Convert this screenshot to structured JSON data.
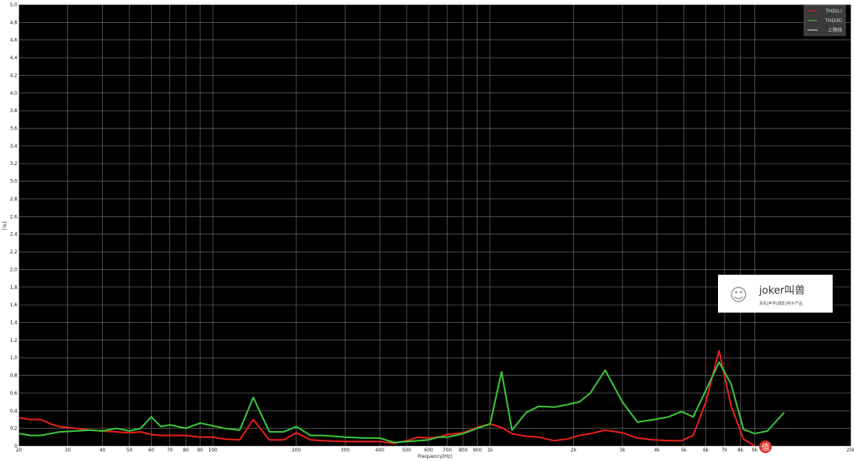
{
  "chart_data": {
    "type": "line",
    "xlabel": "Frequency[Hz]",
    "ylabel": "[%]",
    "xscale": "log",
    "xlim": [
      20,
      20000
    ],
    "ylim": [
      0,
      5
    ],
    "grid": true,
    "legend_position": "top-right",
    "background": "#000000",
    "y_ticks": [
      "0",
      "0,2",
      "0,4",
      "0,6",
      "0,8",
      "1,0",
      "1,2",
      "1,4",
      "1,6",
      "1,8",
      "2,0",
      "2,2",
      "2,4",
      "2,6",
      "2,8",
      "3,0",
      "3,2",
      "3,4",
      "3,6",
      "3,8",
      "4,0",
      "4,2",
      "4,4",
      "4,6",
      "4,8",
      "5,0"
    ],
    "x_ticks": [
      {
        "value": 20,
        "label": "20"
      },
      {
        "value": 30,
        "label": "30"
      },
      {
        "value": 40,
        "label": "40"
      },
      {
        "value": 50,
        "label": "50"
      },
      {
        "value": 60,
        "label": "60"
      },
      {
        "value": 70,
        "label": "70"
      },
      {
        "value": 80,
        "label": "80"
      },
      {
        "value": 90,
        "label": "90"
      },
      {
        "value": 100,
        "label": "100"
      },
      {
        "value": 200,
        "label": "200"
      },
      {
        "value": 300,
        "label": "300"
      },
      {
        "value": 400,
        "label": "400"
      },
      {
        "value": 500,
        "label": "500"
      },
      {
        "value": 600,
        "label": "600"
      },
      {
        "value": 700,
        "label": "700"
      },
      {
        "value": 800,
        "label": "800"
      },
      {
        "value": 900,
        "label": "900"
      },
      {
        "value": 1000,
        "label": "1k"
      },
      {
        "value": 2000,
        "label": "2k"
      },
      {
        "value": 3000,
        "label": "3k"
      },
      {
        "value": 4000,
        "label": "4k"
      },
      {
        "value": 5000,
        "label": "5k"
      },
      {
        "value": 6000,
        "label": "6k"
      },
      {
        "value": 7000,
        "label": "7k"
      },
      {
        "value": 8000,
        "label": "8k"
      },
      {
        "value": 9000,
        "label": "9k"
      },
      {
        "value": 20000,
        "label": "20k"
      }
    ],
    "series": [
      {
        "name": "THD(L)",
        "color": "#e8201c",
        "points": [
          [
            20,
            0.32
          ],
          [
            22,
            0.3
          ],
          [
            24,
            0.3
          ],
          [
            26,
            0.25
          ],
          [
            28,
            0.22
          ],
          [
            32,
            0.2
          ],
          [
            36,
            0.18
          ],
          [
            40,
            0.17
          ],
          [
            45,
            0.16
          ],
          [
            50,
            0.15
          ],
          [
            55,
            0.16
          ],
          [
            60,
            0.13
          ],
          [
            65,
            0.12
          ],
          [
            70,
            0.12
          ],
          [
            80,
            0.12
          ],
          [
            90,
            0.1
          ],
          [
            100,
            0.1
          ],
          [
            110,
            0.08
          ],
          [
            125,
            0.07
          ],
          [
            140,
            0.3
          ],
          [
            160,
            0.07
          ],
          [
            180,
            0.07
          ],
          [
            200,
            0.15
          ],
          [
            225,
            0.07
          ],
          [
            250,
            0.06
          ],
          [
            300,
            0.05
          ],
          [
            350,
            0.05
          ],
          [
            400,
            0.05
          ],
          [
            450,
            0.03
          ],
          [
            500,
            0.06
          ],
          [
            550,
            0.1
          ],
          [
            600,
            0.09
          ],
          [
            650,
            0.1
          ],
          [
            700,
            0.13
          ],
          [
            750,
            0.14
          ],
          [
            800,
            0.15
          ],
          [
            900,
            0.21
          ],
          [
            1000,
            0.25
          ],
          [
            1100,
            0.21
          ],
          [
            1200,
            0.14
          ],
          [
            1350,
            0.11
          ],
          [
            1500,
            0.1
          ],
          [
            1700,
            0.06
          ],
          [
            1900,
            0.08
          ],
          [
            2100,
            0.12
          ],
          [
            2300,
            0.14
          ],
          [
            2600,
            0.18
          ],
          [
            3000,
            0.15
          ],
          [
            3400,
            0.09
          ],
          [
            3900,
            0.07
          ],
          [
            4400,
            0.06
          ],
          [
            4900,
            0.06
          ],
          [
            5400,
            0.12
          ],
          [
            6000,
            0.5
          ],
          [
            6700,
            1.08
          ],
          [
            7400,
            0.45
          ],
          [
            8200,
            0.08
          ],
          [
            9000,
            0.0
          ]
        ]
      },
      {
        "name": "THD(R)",
        "color": "#3cc83c",
        "points": [
          [
            20,
            0.14
          ],
          [
            22,
            0.12
          ],
          [
            24,
            0.12
          ],
          [
            26,
            0.14
          ],
          [
            28,
            0.16
          ],
          [
            32,
            0.17
          ],
          [
            36,
            0.18
          ],
          [
            40,
            0.17
          ],
          [
            45,
            0.2
          ],
          [
            50,
            0.17
          ],
          [
            55,
            0.2
          ],
          [
            60,
            0.33
          ],
          [
            65,
            0.22
          ],
          [
            70,
            0.24
          ],
          [
            80,
            0.2
          ],
          [
            90,
            0.26
          ],
          [
            100,
            0.23
          ],
          [
            110,
            0.2
          ],
          [
            125,
            0.18
          ],
          [
            140,
            0.55
          ],
          [
            160,
            0.16
          ],
          [
            180,
            0.16
          ],
          [
            200,
            0.22
          ],
          [
            225,
            0.12
          ],
          [
            250,
            0.12
          ],
          [
            300,
            0.1
          ],
          [
            350,
            0.09
          ],
          [
            400,
            0.09
          ],
          [
            450,
            0.04
          ],
          [
            500,
            0.05
          ],
          [
            550,
            0.06
          ],
          [
            600,
            0.07
          ],
          [
            650,
            0.1
          ],
          [
            700,
            0.1
          ],
          [
            750,
            0.12
          ],
          [
            800,
            0.14
          ],
          [
            900,
            0.2
          ],
          [
            1000,
            0.25
          ],
          [
            1100,
            0.84
          ],
          [
            1200,
            0.18
          ],
          [
            1350,
            0.38
          ],
          [
            1500,
            0.45
          ],
          [
            1700,
            0.44
          ],
          [
            1900,
            0.47
          ],
          [
            2100,
            0.5
          ],
          [
            2300,
            0.6
          ],
          [
            2600,
            0.86
          ],
          [
            3000,
            0.5
          ],
          [
            3400,
            0.27
          ],
          [
            3900,
            0.3
          ],
          [
            4400,
            0.33
          ],
          [
            4900,
            0.39
          ],
          [
            5400,
            0.33
          ],
          [
            6000,
            0.63
          ],
          [
            6700,
            0.95
          ],
          [
            7400,
            0.7
          ],
          [
            8200,
            0.19
          ],
          [
            9000,
            0.14
          ],
          [
            10000,
            0.17
          ],
          [
            11500,
            0.38
          ]
        ]
      }
    ]
  },
  "legend": {
    "items": [
      {
        "label": "THD(L)",
        "color": "#e8201c"
      },
      {
        "label": "THD(R)",
        "color": "#3cc83c"
      },
      {
        "label": "上限线",
        "color": "#dddddd"
      }
    ]
  },
  "watermark": {
    "name": "joker叫兽",
    "subtitle": "耳机|声学|摄影|电子产品"
  }
}
